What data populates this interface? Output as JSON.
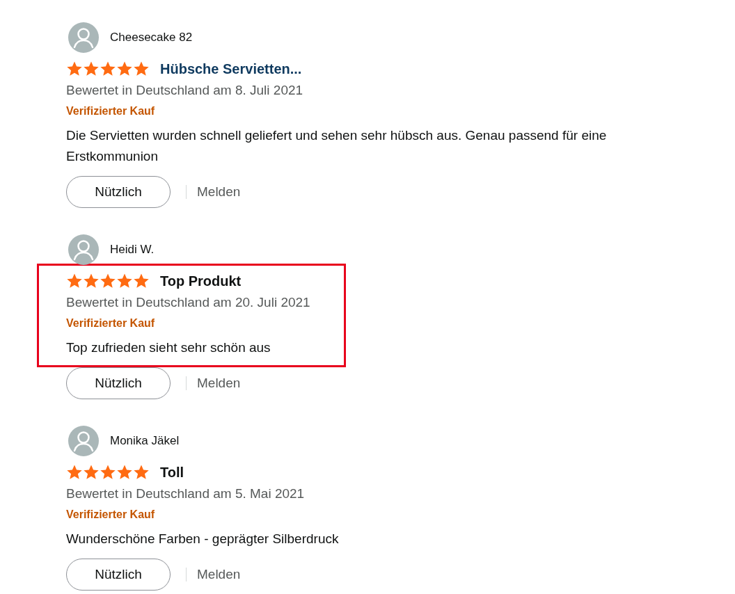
{
  "reviews": [
    {
      "author": "Cheesecake 82",
      "stars": 5,
      "title": "Hübsche Servietten...",
      "title_link": true,
      "highlighted": false,
      "date": "Bewertet in Deutschland am 8. Juli 2021",
      "badge": "Verifizierter Kauf",
      "body": "Die Servietten wurden schnell geliefert und sehen sehr hübsch aus. Genau passend für eine Erstkommunion",
      "helpful_button": "Nützlich",
      "report_link": "Melden"
    },
    {
      "author": "Heidi W.",
      "stars": 5,
      "title": "Top Produkt",
      "title_link": false,
      "highlighted": true,
      "date": "Bewertet in Deutschland am 20. Juli 2021",
      "badge": "Verifizierter Kauf",
      "body": "Top zufrieden sieht sehr schön aus",
      "helpful_button": "Nützlich",
      "report_link": "Melden"
    },
    {
      "author": "Monika Jäkel",
      "stars": 5,
      "title": "Toll",
      "title_link": false,
      "highlighted": false,
      "date": "Bewertet in Deutschland am 5. Mai 2021",
      "badge": "Verifizierter Kauf",
      "body": "Wunderschöne Farben - geprägter Silberdruck",
      "helpful_button": "Nützlich",
      "report_link": "Melden"
    }
  ]
}
